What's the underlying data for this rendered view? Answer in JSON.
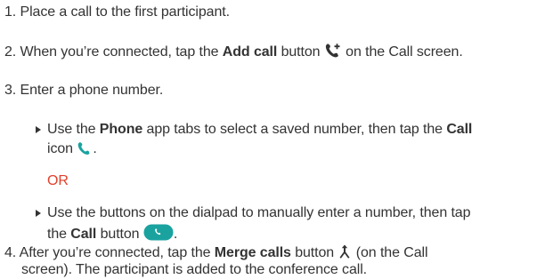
{
  "steps": [
    {
      "number": "1.",
      "text": "Place a call to the first participant."
    },
    {
      "number": "2.",
      "text_before": "When you’re connected, tap the ",
      "bold": "Add call",
      "text_mid": " button ",
      "text_after": " on the Call screen."
    },
    {
      "number": "3.",
      "text": "Enter a phone number."
    },
    {
      "number": "4.",
      "text_before": "After you’re connected, tap the ",
      "bold": "Merge calls",
      "text_mid": " button ",
      "text_after": " (on the Call",
      "line2": "screen). The participant is added to the conference call."
    }
  ],
  "options": [
    {
      "line1_before": "Use the ",
      "line1_bold": "Phone",
      "line1_after": " app tabs to select a saved number, then tap the ",
      "line1_bold2": "Call",
      "line2_before": "icon ",
      "line2_after": "."
    },
    {
      "line1": "Use the buttons on the dialpad to manually enter a number, then tap",
      "line2_before": "the ",
      "line2_bold": "Call",
      "line2_mid": " button ",
      "line2_after": "."
    }
  ],
  "or_label": "OR",
  "icons": {
    "add_call": "add-call-icon",
    "phone": "phone-icon",
    "call_button": "call-button-icon",
    "merge_calls": "merge-calls-icon"
  },
  "colors": {
    "text": "#333333",
    "or_label": "#e0402a",
    "phone_icon": "#1aa29f",
    "call_button": "#1aa29f"
  }
}
